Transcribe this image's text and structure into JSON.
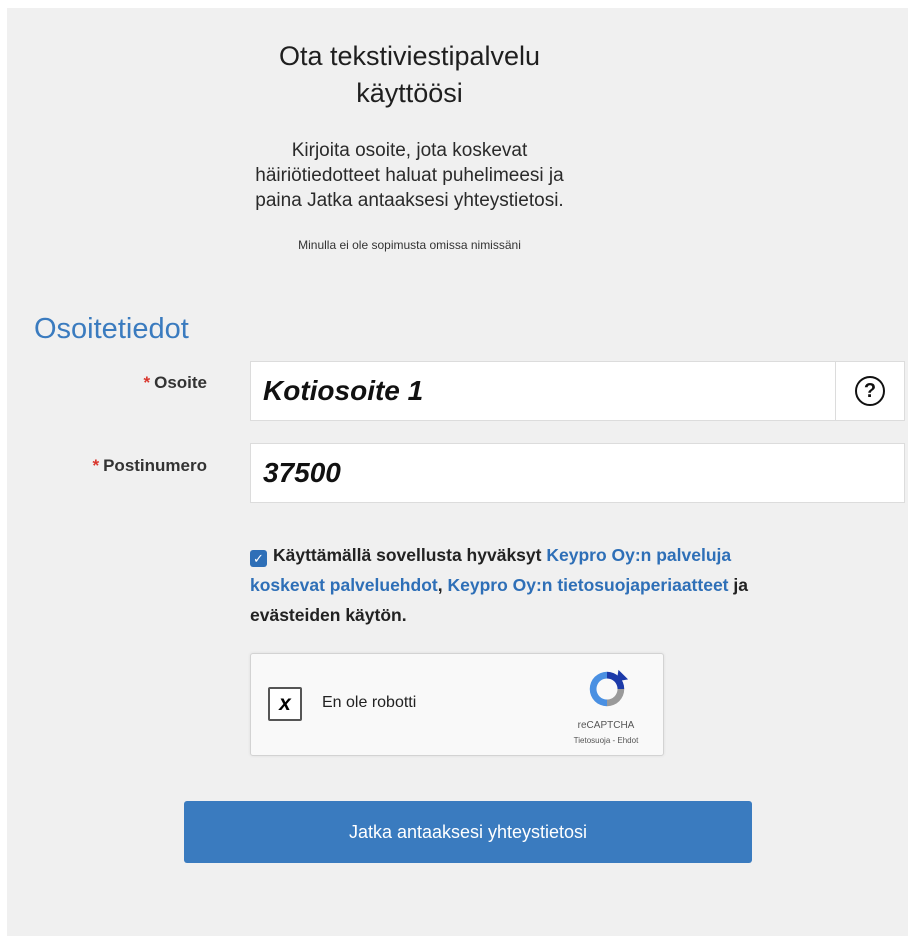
{
  "header": {
    "title_line1": "Ota tekstiviestipalvelu",
    "title_line2": "käyttöösi",
    "intro_line1": "Kirjoita osoite, jota koskevat",
    "intro_line2": "häiriötiedotteet haluat puhelimeesi ja",
    "intro_line3": "paina Jatka antaaksesi yhteystietosi.",
    "note_link": "Minulla ei ole sopimusta omissa nimissäni"
  },
  "form": {
    "section_title": "Osoitetiedot",
    "required_marker": "*",
    "address": {
      "label": "Osoite",
      "value": "Kotiosoite 1",
      "help_icon": "question-circle-icon",
      "help_glyph": "?"
    },
    "postal": {
      "label": "Postinumero",
      "value": "37500"
    }
  },
  "consent": {
    "checked": true,
    "check_glyph": "✓",
    "prefix": "Käyttämällä sovellusta hyväksyt",
    "link1": "Keypro Oy:n palveluja koskevat palveluehdot",
    "separator": ",",
    "link2": "Keypro Oy:n tietosuojaperiaatteet",
    "suffix": "ja evästeiden käytön."
  },
  "recaptcha": {
    "checkbox_mark": "x",
    "label": "En ole robotti",
    "brand": "reCAPTCHA",
    "terms": "Tietosuoja - Ehdot",
    "logo_icon": "recaptcha-logo-icon"
  },
  "submit": {
    "label": "Jatka antaaksesi yhteystietosi"
  },
  "colors": {
    "accent": "#3a7bbf",
    "link": "#2e6fb7",
    "required": "#d9342b",
    "panel": "#f0f0f0"
  }
}
